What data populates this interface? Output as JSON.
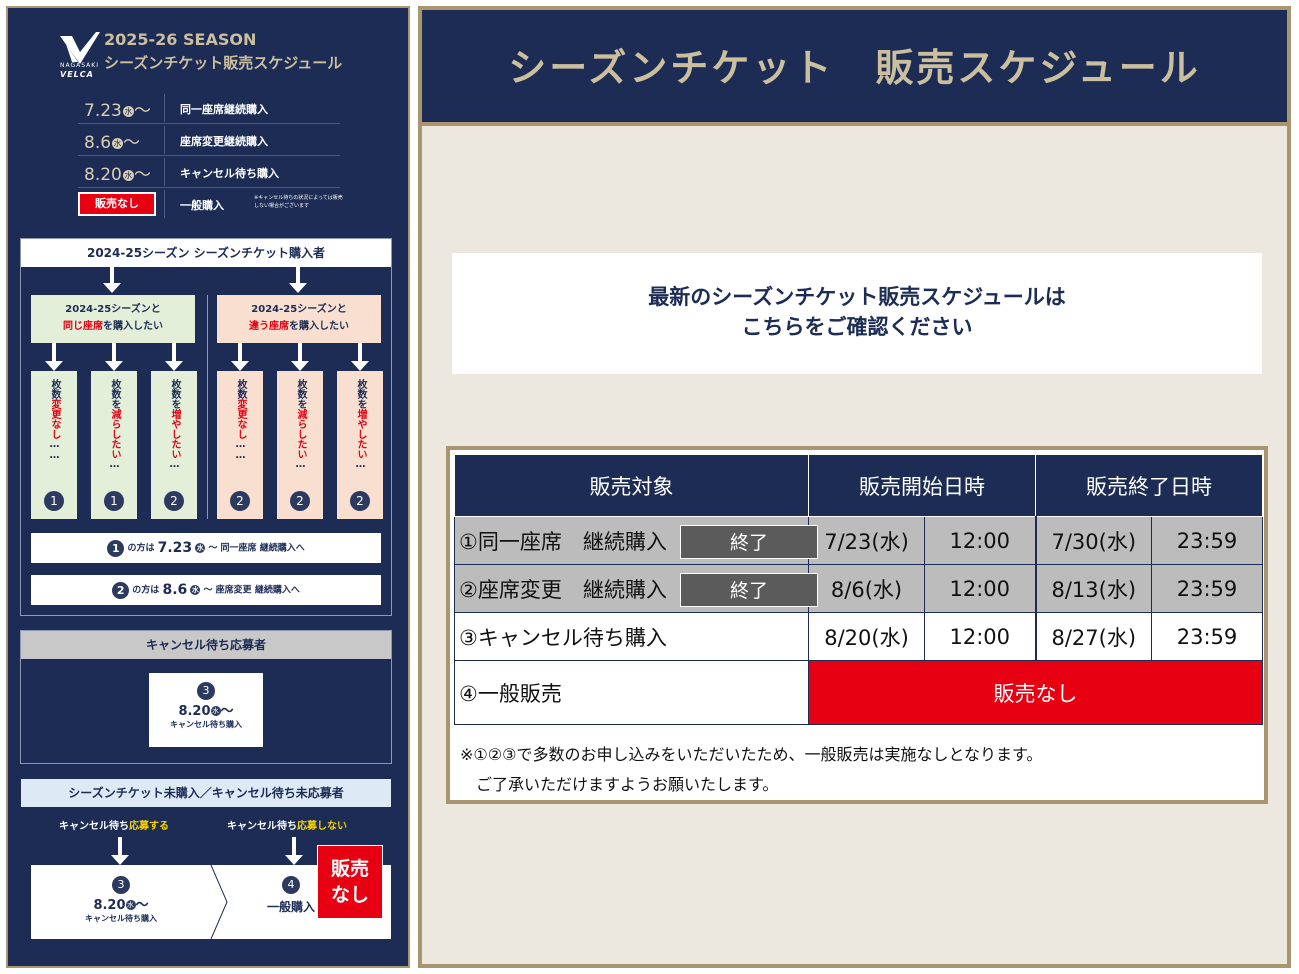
{
  "poster": {
    "logo_top": "NAGASAKI",
    "logo_bottom": "VELCA",
    "season": "2025-26 SEASON",
    "title": "シーズンチケット販売スケジュール",
    "schedule": [
      {
        "date": "7.23",
        "weekday": "水",
        "tilde": "〜",
        "label": "同一座席継続購入"
      },
      {
        "date": "8.6",
        "weekday": "水",
        "tilde": "〜",
        "label": "座席変更継続購入"
      },
      {
        "date": "8.20",
        "weekday": "水",
        "tilde": "〜",
        "label": "キャンセル待ち購入"
      }
    ],
    "general": {
      "badge": "販売なし",
      "label": "一般購入",
      "note": "※キャンセル待ちの状況によっては販売しない場合がございます"
    },
    "section1": {
      "head": "2024-25シーズン シーズンチケット購入者",
      "group_same": {
        "line1": "2024-25シーズンと",
        "red": "同じ座席",
        "rest": "を購入したい"
      },
      "group_diff": {
        "line1": "2024-25シーズンと",
        "red": "違う座席",
        "rest": "を購入したい"
      },
      "columns": [
        {
          "pre": "枚数",
          "red": "変更なし",
          "dots": "……",
          "num": "1"
        },
        {
          "pre": "枚数を",
          "red": "減らしたい",
          "dots": "…",
          "num": "1"
        },
        {
          "pre": "枚数を",
          "red": "増やしたい",
          "dots": "…",
          "num": "2"
        },
        {
          "pre": "枚数",
          "red": "変更なし",
          "dots": "……",
          "num": "2"
        },
        {
          "pre": "枚数を",
          "red": "減らしたい",
          "dots": "…",
          "num": "2"
        },
        {
          "pre": "枚数を",
          "red": "増やしたい",
          "dots": "…",
          "num": "2"
        }
      ],
      "bar1": {
        "num": "1",
        "pre": "の方は",
        "date": "7.23",
        "weekday": "水",
        "post": "〜 同一座席 継続購入へ"
      },
      "bar2": {
        "num": "2",
        "pre": "の方は",
        "date": "8.6",
        "weekday": "水",
        "post": "〜 座席変更 継続購入へ"
      }
    },
    "section2": {
      "head": "キャンセル待ち応募者",
      "num": "3",
      "date": "8.20",
      "weekday": "水",
      "tilde": "〜",
      "sub": "キャンセル待ち購入"
    },
    "section3": {
      "head": "シーズンチケット未購入／キャンセル待ち未応募者",
      "choice_yes_pre": "キャンセル待ち",
      "choice_yes": "応募する",
      "choice_no_pre": "キャンセル待ち",
      "choice_no": "応募しない",
      "left_num": "3",
      "left_date": "8.20",
      "left_weekday": "水",
      "left_tilde": "〜",
      "left_sub": "キャンセル待ち購入",
      "right_num": "4",
      "right_sub": "一般購入",
      "nosale_line1": "販売",
      "nosale_line2": "なし"
    }
  },
  "main": {
    "header_title": "シーズンチケット　販売スケジュール",
    "notice_line1": "最新のシーズンチケット販売スケジュールは",
    "notice_line2": "こちらをご確認ください",
    "table": {
      "headers": [
        "販売対象",
        "販売開始日時",
        "販売終了日時"
      ],
      "rows": [
        {
          "name": "①同一座席　継続購入",
          "status": "終了",
          "start_date": "7/23(水)",
          "start_time": "12:00",
          "end_date": "7/30(水)",
          "end_time": "23:59"
        },
        {
          "name": "②座席変更　継続購入",
          "status": "終了",
          "start_date": "8/6(水)",
          "start_time": "12:00",
          "end_date": "8/13(水)",
          "end_time": "23:59"
        },
        {
          "name": "③キャンセル待ち購入",
          "start_date": "8/20(水)",
          "start_time": "12:00",
          "end_date": "8/27(水)",
          "end_time": "23:59"
        }
      ],
      "general_row": {
        "name": "④一般販売",
        "value": "販売なし"
      },
      "note_line1": "※①②③で多数のお申し込みをいただいたため、一般販売は実施なしとなります。",
      "note_line2": "　ご了承いただけますようお願いたします。"
    }
  },
  "colors": {
    "navy": "#1c2c55",
    "gold": "#a99670",
    "red": "#e60012",
    "beige": "#ece8df",
    "ended_gray": "#5b5b5b"
  }
}
